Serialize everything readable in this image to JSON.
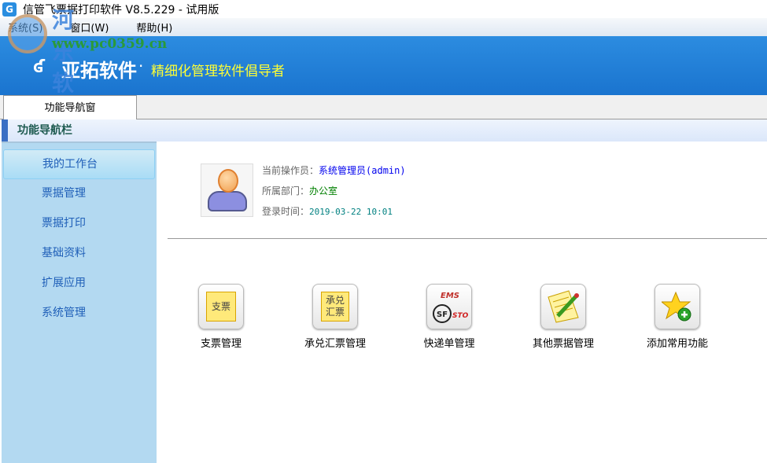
{
  "window": {
    "title": "信管飞票据打印软件 V8.5.229 - 试用版"
  },
  "menu": [
    "系统(S)",
    "窗口(W)",
    "帮助(H)"
  ],
  "banner": {
    "brand": "亚拓软件",
    "dot": "·",
    "slogan": "精细化管理软件倡导者"
  },
  "watermark": {
    "text": "河东软件园",
    "url": "www.pc0359.cn"
  },
  "tab": {
    "label": "功能导航窗"
  },
  "nav": {
    "header": "功能导航栏",
    "items": [
      "我的工作台",
      "票据管理",
      "票据打印",
      "基础资料",
      "扩展应用",
      "系统管理"
    ],
    "active": 0
  },
  "user": {
    "operator_label": "当前操作员：",
    "operator": "系统管理员(admin)",
    "dept_label": "所属部门：",
    "dept": "办公室",
    "login_label": "登录时间：",
    "login": "2019-03-22 10:01"
  },
  "functions": [
    {
      "label": "支票管理",
      "icon": "cheque-icon",
      "icon_text": "支票"
    },
    {
      "label": "承兑汇票管理",
      "icon": "acceptance-bill-icon",
      "icon_text": "承兑汇票"
    },
    {
      "label": "快递单管理",
      "icon": "express-icon",
      "icon_text": "EMS SF STO"
    },
    {
      "label": "其他票据管理",
      "icon": "notepad-pencil-icon"
    },
    {
      "label": "添加常用功能",
      "icon": "star-add-icon"
    }
  ],
  "colors": {
    "banner": "#1f80d8",
    "sidebar": "#b3d9f1",
    "operator": "#0000ee",
    "dept": "#008000",
    "login": "#008080"
  }
}
